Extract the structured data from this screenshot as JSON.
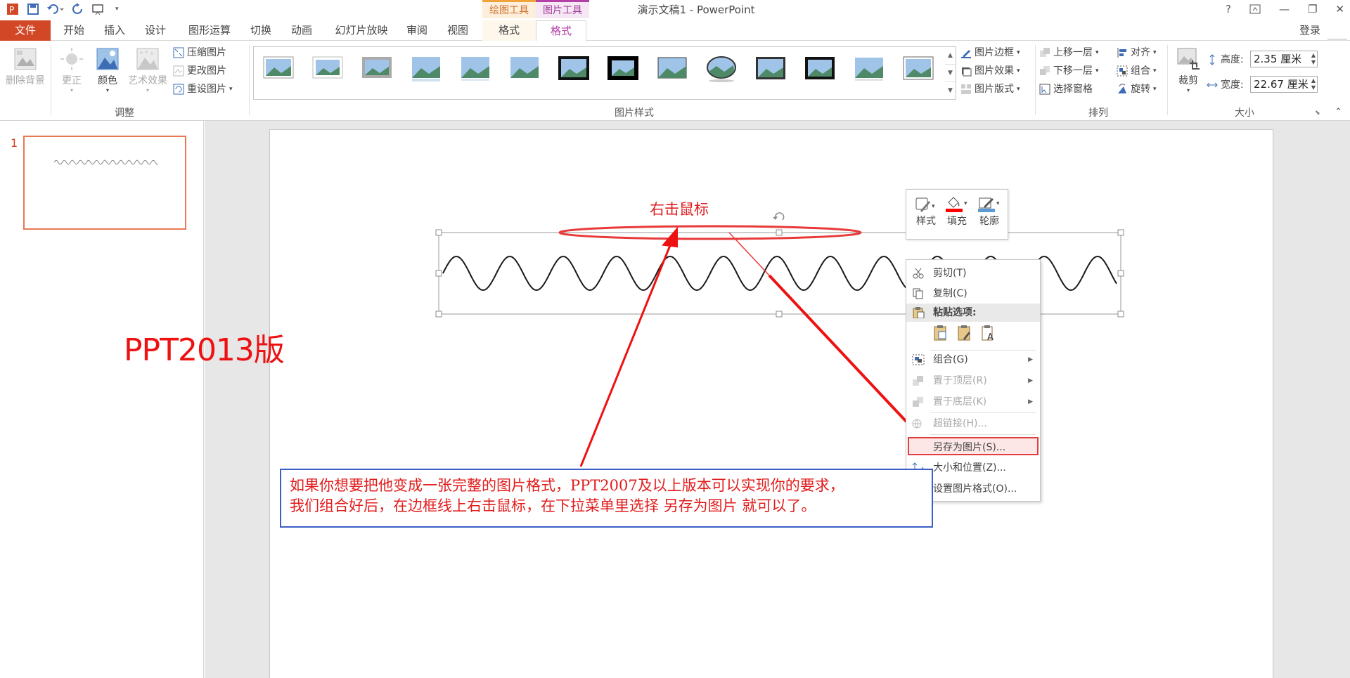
{
  "window": {
    "title": "演示文稿1 - PowerPoint",
    "help": "?",
    "minimize": "—",
    "restore": "❐",
    "close": "✕"
  },
  "context_tabs": {
    "drawing_tools": "绘图工具",
    "picture_tools": "图片工具"
  },
  "tabs": [
    "文件",
    "开始",
    "插入",
    "设计",
    "图形运算",
    "切换",
    "动画",
    "幻灯片放映",
    "审阅",
    "视图",
    "格式",
    "格式"
  ],
  "login": "登录",
  "ribbon": {
    "adjust": {
      "remove_bg": "删除背景",
      "correct": "更正",
      "color": "颜色",
      "artistic": "艺术效果",
      "compress": "压缩图片",
      "change": "更改图片",
      "reset": "重设图片",
      "group_label": "调整"
    },
    "styles": {
      "border": "图片边框",
      "effects": "图片效果",
      "layout": "图片版式",
      "group_label": "图片样式"
    },
    "arrange": {
      "forward": "上移一层",
      "backward": "下移一层",
      "selection_pane": "选择窗格",
      "align": "对齐",
      "group": "组合",
      "rotate": "旋转",
      "group_label": "排列"
    },
    "size": {
      "crop": "裁剪",
      "height_label": "高度:",
      "height_value": "2.35 厘米",
      "width_label": "宽度:",
      "width_value": "22.67 厘米",
      "group_label": "大小"
    }
  },
  "slide_panel": {
    "slide_number": "1"
  },
  "minibar": {
    "style": "样式",
    "fill": "填充",
    "outline": "轮廓"
  },
  "context_menu": {
    "cut": "剪切(T)",
    "copy": "复制(C)",
    "paste_options": "粘贴选项:",
    "group": "组合(G)",
    "bring_front": "置于顶层(R)",
    "send_back": "置于底层(K)",
    "hyperlink": "超链接(H)...",
    "save_as_picture": "另存为图片(S)...",
    "size_position": "大小和位置(Z)...",
    "format_picture": "设置图片格式(O)..."
  },
  "annotations": {
    "version": "PPT2013版",
    "right_click": "右击鼠标",
    "note_line1": "如果你想要把他变成一张完整的图片格式，PPT2007及以上版本可以实现你的要求，",
    "note_line2": "我们组合好后，在边框线上右击鼠标，在下拉菜单里选择  另存为图片  就可以了。"
  },
  "colors": {
    "file_tab": "#d24726",
    "annotation_red": "#ee1111",
    "note_border": "#3b5fc4",
    "picture_tools": "#b43fa6",
    "drawing_tools": "#f0a33b"
  }
}
